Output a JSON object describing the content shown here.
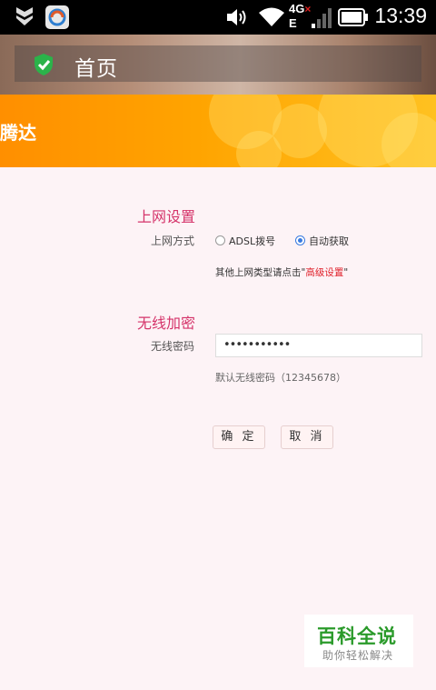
{
  "status_bar": {
    "time": "13:39",
    "network": "4G",
    "network_sub": "E",
    "icons": [
      "shield-notification-icon",
      "app-notification-icon",
      "volume-icon",
      "wifi-icon",
      "signal-icon",
      "battery-icon"
    ]
  },
  "app_bar": {
    "title": "首页",
    "icon": "green-shield-check-icon"
  },
  "banner": {
    "brand": "腾达",
    "color": "#ffa400"
  },
  "internet": {
    "section_title": "上网设置",
    "method_label": "上网方式",
    "options": [
      {
        "label": "ADSL拨号",
        "selected": false
      },
      {
        "label": "自动获取",
        "selected": true
      }
    ],
    "hint_prefix": "其他上网类型请点击\"",
    "hint_link": "高级设置",
    "hint_suffix": "\""
  },
  "wireless": {
    "section_title": "无线加密",
    "password_label": "无线密码",
    "password_value": "•••••••••••",
    "default_hint": "默认无线密码（12345678）"
  },
  "actions": {
    "ok": "确 定",
    "cancel": "取 消"
  },
  "watermark": {
    "title": "百科全说",
    "subtitle": "助你轻松解决"
  }
}
